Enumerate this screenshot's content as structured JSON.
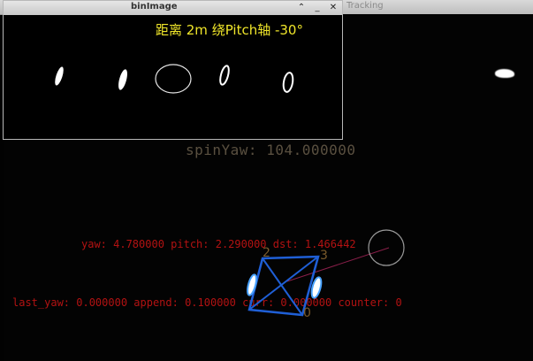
{
  "windows": {
    "tracking": {
      "title": "Tracking"
    },
    "bin_image": {
      "title": "binImage",
      "buttons": {
        "up": "⌃",
        "minimize": "_",
        "close": "✕"
      },
      "caption": "距离 2m 绕Pitch轴 -30°"
    }
  },
  "overlay": {
    "spin_yaw": "spinYaw: 104.000000",
    "yaw_line": "yaw: 4.780000 pitch: 2.290000 dst: 1.466442",
    "last_line": "last_yaw: 0.000000 append: 0.100000 curr: 0.000000 counter: 0",
    "corner_labels": [
      "2",
      "3",
      "0"
    ]
  },
  "colors": {
    "overlay_text": "#b31212",
    "spin_text": "#5a5040",
    "caption": "#f0e62a",
    "box": "#1f5fd6",
    "light_bar": "#4aa3ff"
  }
}
